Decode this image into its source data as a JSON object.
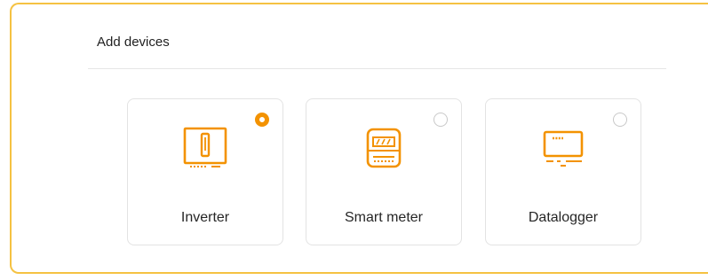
{
  "section": {
    "title": "Add devices"
  },
  "devices": [
    {
      "label": "Inverter",
      "icon": "inverter-icon",
      "selected": true
    },
    {
      "label": "Smart meter",
      "icon": "smart-meter-icon",
      "selected": false
    },
    {
      "label": "Datalogger",
      "icon": "datalogger-icon",
      "selected": false
    }
  ],
  "colors": {
    "accent": "#f39200",
    "frame_border": "#f5c242",
    "card_border": "#e3e3e3"
  }
}
